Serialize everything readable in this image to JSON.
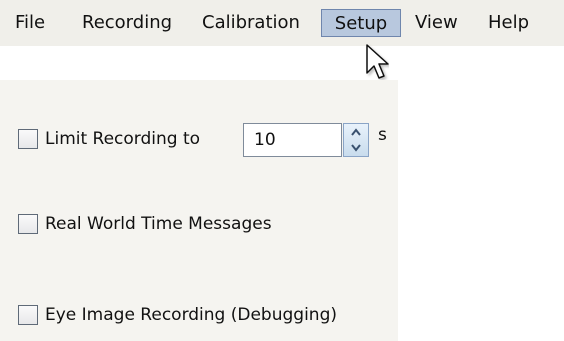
{
  "menubar": {
    "items": [
      {
        "label": "File"
      },
      {
        "label": "Recording"
      },
      {
        "label": "Calibration"
      },
      {
        "label": "Setup"
      },
      {
        "label": "View"
      },
      {
        "label": "Help"
      }
    ]
  },
  "pointer": {
    "icon": "arrow-pointer-icon"
  },
  "setup": {
    "limit_recording": {
      "label": "Limit Recording to",
      "value": "10",
      "unit": "s",
      "checked": false
    },
    "real_world_time_messages": {
      "label": "Real World Time Messages",
      "checked": false
    },
    "eye_image_recording": {
      "label": "Eye Image Recording (Debugging)",
      "checked": false
    }
  },
  "colors": {
    "menubar_background": "#f0efea",
    "menu_highlight": "#b8c8de",
    "panel_background": "#f5f4f0"
  }
}
